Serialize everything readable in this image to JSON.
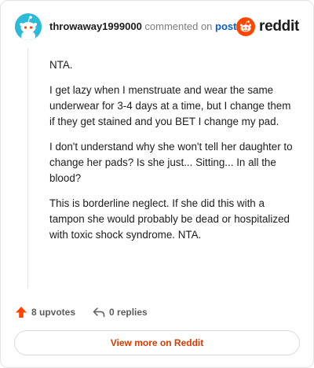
{
  "header": {
    "username": "throwaway1999000",
    "commented_text": "commented on",
    "post_link": "post",
    "brand": "reddit"
  },
  "comment": {
    "paragraphs": [
      "NTA.",
      "I get lazy when I menstruate and wear the same underwear for 3-4 days at a time, but I change them if they get stained and you BET I change my pad.",
      "I don't understand why she won't tell her daughter to change her pads? Is she just... Sitting... In all the blood?",
      "This is borderline neglect. If she did this with a tampon she would probably be dead or hospitalized with toxic shock syndrome. NTA."
    ]
  },
  "actions": {
    "upvotes": "8 upvotes",
    "replies": "0 replies"
  },
  "footer": {
    "view_more": "View more on Reddit"
  },
  "colors": {
    "avatar_bg": "#2bbbd8",
    "reddit_orange": "#ff4500",
    "link_blue": "#0a5cc9",
    "view_more_text": "#d93a00"
  },
  "icons": {
    "avatar": "snoo-avatar-icon",
    "brand": "reddit-logo-icon",
    "upvote": "upvote-arrow-icon",
    "reply": "reply-arrow-icon"
  }
}
